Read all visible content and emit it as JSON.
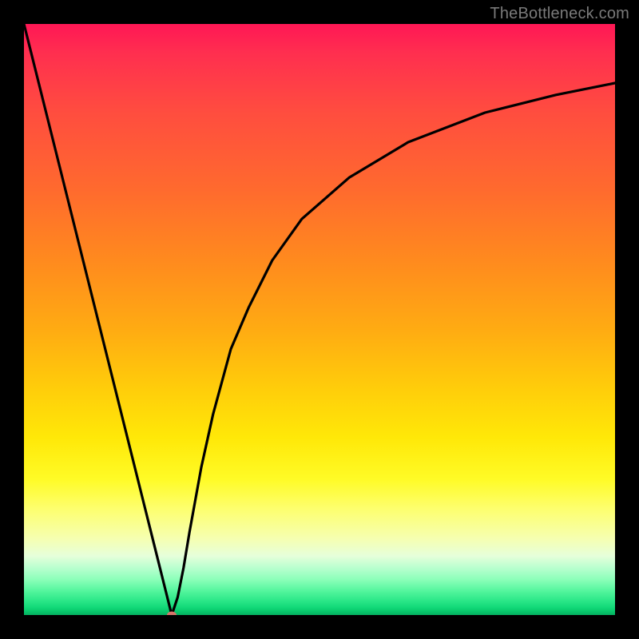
{
  "attribution": "TheBottleneck.com",
  "chart_data": {
    "type": "line",
    "title": "",
    "xlabel": "",
    "ylabel": "",
    "x": [
      0,
      5,
      10,
      15,
      20,
      22,
      24,
      25,
      26,
      27,
      28,
      30,
      32,
      35,
      38,
      42,
      47,
      55,
      65,
      78,
      90,
      100
    ],
    "values": [
      100,
      80,
      60,
      40,
      20,
      12,
      4,
      0,
      3,
      8,
      14,
      25,
      34,
      45,
      52,
      60,
      67,
      74,
      80,
      85,
      88,
      90
    ],
    "xlim": [
      0,
      100
    ],
    "ylim": [
      0,
      100
    ],
    "marker": {
      "x": 25,
      "y": 0
    },
    "gradient_colors_top_to_bottom": [
      "#ff1755",
      "#ff8a1e",
      "#ffe808",
      "#fdff6e",
      "#52f59c",
      "#05b060"
    ]
  }
}
